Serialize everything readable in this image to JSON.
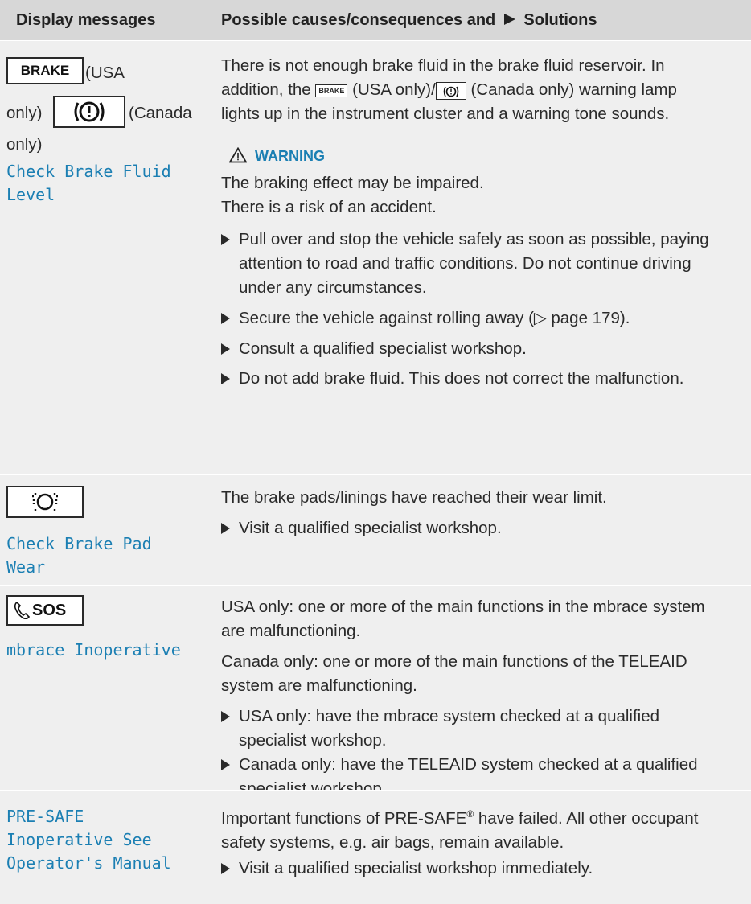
{
  "header": {
    "col1": "Display messages",
    "col2_a": "Possible causes/consequences and",
    "col2_b": "Solutions"
  },
  "rows": [
    {
      "icons": {
        "brake": "BRAKE",
        "circle": "brake-warning-circle-icon"
      },
      "label_usa": "(USA",
      "label_only1": "only)",
      "label_canada": "(Canada",
      "label_only2": "only)",
      "message_line1": "Check Brake Fluid",
      "message_line2": "Level",
      "cause_l1": "There is not enough brake fluid in the brake fluid reservoir. In",
      "cause_l2a": "addition, the",
      "cause_l2b": "(USA only)/",
      "cause_l2c": "(Canada only) warning lamp",
      "cause_l3": "lights up in the instrument cluster and a warning tone sounds.",
      "warning_title": "WARNING",
      "warning_l1": "The braking effect may be impaired.",
      "warning_l2": "There is a risk of an accident.",
      "b1_l1": "Pull over and stop the vehicle safely as soon as possible, paying",
      "b1_l2": "attention to road and traffic conditions. Do not continue driving",
      "b1_l3": "under any circumstances.",
      "b2": "Secure the vehicle against rolling away (▷ page 179).",
      "b3": "Consult a qualified specialist workshop.",
      "b4": "Do not add brake fluid. This does not correct the malfunction."
    },
    {
      "icon": "brake-pad-wear-icon",
      "message_line1": "Check Brake Pad",
      "message_line2": "Wear",
      "cause": "The brake pads/linings have reached their wear limit.",
      "b1": "Visit a qualified specialist workshop."
    },
    {
      "icon_text": "SOS",
      "message": "mbrace Inoperative",
      "p1_l1": "USA only: one or more of the main functions in the mbrace system",
      "p1_l2": "are malfunctioning.",
      "p2_l1": "Canada only: one or more of the main functions of the TELEAID",
      "p2_l2": "system are malfunctioning.",
      "b1_l1": "USA only: have the mbrace system checked at a qualified",
      "b1_l2": "specialist workshop.",
      "b2_l1": "Canada only: have the TELEAID system checked at a qualified",
      "b2_l2": "specialist workshop."
    },
    {
      "message_line1": "PRE-SAFE",
      "message_line2": "Inoperative See",
      "message_line3": "Operator's Manual",
      "p1_l1a": "Important functions of PRE-SAFE",
      "p1_l1_sup": "®",
      "p1_l1b": " have failed. All other occupant",
      "p1_l2": "safety systems, e.g. air bags, remain available.",
      "b1": "Visit a qualified specialist workshop immediately."
    }
  ]
}
